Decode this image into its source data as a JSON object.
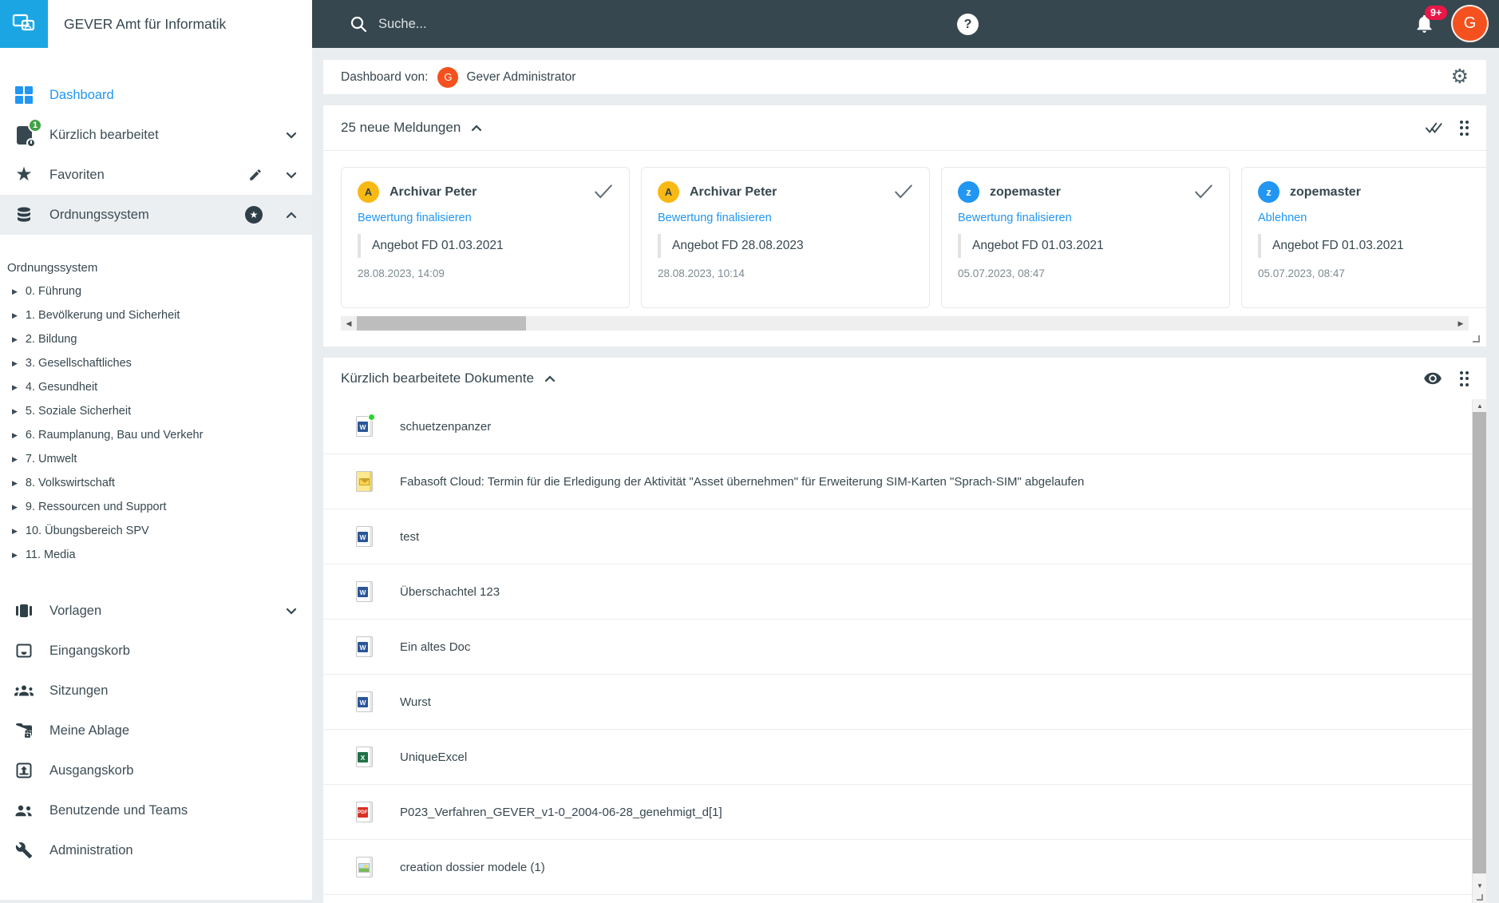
{
  "app": {
    "title": "GEVER Amt für Informatik"
  },
  "topbar": {
    "search_placeholder": "Suche...",
    "help_glyph": "?",
    "notification_count": "9+",
    "avatar_initial": "G"
  },
  "sidebar": {
    "items": [
      {
        "label": "Dashboard"
      },
      {
        "label": "Kürzlich bearbeitet",
        "badge": "1"
      },
      {
        "label": "Favoriten"
      },
      {
        "label": "Ordnungssystem"
      }
    ],
    "tree": {
      "root": "Ordnungssystem",
      "nodes": [
        "0. Führung",
        "1. Bevölkerung und Sicherheit",
        "2. Bildung",
        "3. Gesellschaftliches",
        "4. Gesundheit",
        "5. Soziale Sicherheit",
        "6. Raumplanung, Bau und Verkehr",
        "7. Umwelt",
        "8. Volkswirtschaft",
        "9. Ressourcen und Support",
        "10. Übungsbereich SPV",
        "11. Media"
      ]
    },
    "bottom": [
      "Vorlagen",
      "Eingangskorb",
      "Sitzungen",
      "Meine Ablage",
      "Ausgangskorb",
      "Benutzende und Teams",
      "Administration"
    ]
  },
  "dashboard_header": {
    "label": "Dashboard von:",
    "avatar_initial": "G",
    "user": "Gever Administrator"
  },
  "notifications": {
    "title": "25 neue Meldungen",
    "cards": [
      {
        "user": "Archivar Peter",
        "initial": "A",
        "action": "Bewertung finalisieren",
        "subject": "Angebot FD 01.03.2021",
        "date": "28.08.2023, 14:09"
      },
      {
        "user": "Archivar Peter",
        "initial": "A",
        "action": "Bewertung finalisieren",
        "subject": "Angebot FD 28.08.2023",
        "date": "28.08.2023, 10:14"
      },
      {
        "user": "zopemaster",
        "initial": "z",
        "action": "Bewertung finalisieren",
        "subject": "Angebot FD 01.03.2021",
        "date": "05.07.2023, 08:47"
      },
      {
        "user": "zopemaster",
        "initial": "z",
        "action": "Ablehnen",
        "subject": "Angebot FD 01.03.2021",
        "date": "05.07.2023, 08:47"
      }
    ]
  },
  "documents": {
    "title": "Kürzlich bearbeitete Dokumente",
    "rows": [
      {
        "name": "schuetzenpanzer",
        "type": "word",
        "unread": true
      },
      {
        "name": "Fabasoft Cloud: Termin für die Erledigung der Aktivität \"Asset übernehmen\" für Erweiterung SIM-Karten \"Sprach-SIM\" abgelaufen",
        "type": "email"
      },
      {
        "name": "test",
        "type": "word"
      },
      {
        "name": "Überschachtel 123",
        "type": "word"
      },
      {
        "name": "Ein altes Doc",
        "type": "word"
      },
      {
        "name": "Wurst",
        "type": "word"
      },
      {
        "name": "UniqueExcel",
        "type": "excel"
      },
      {
        "name": "P023_Verfahren_GEVER_v1-0_2004-06-28_genehmigt_d[1]",
        "type": "pdf"
      },
      {
        "name": "creation dossier modele (1)",
        "type": "image"
      }
    ]
  },
  "glyphs": {
    "star": "★",
    "tree_arrow": "▶",
    "scroll_left": "◀",
    "scroll_right": "▶",
    "scroll_up": "▲",
    "scroll_down": "▼",
    "gear": "⚙",
    "file_word_letter": "W",
    "file_excel_letter": "X",
    "file_pdf_label": "PDF"
  },
  "colors": {
    "topbar": "#37474f",
    "accent_blue": "#2196f3",
    "logo_blue": "#1ba6e3",
    "avatar_orange": "#f4511e",
    "avatar_amber": "#f9b915",
    "badge_green": "#43a047",
    "notif_badge_red": "#e91748",
    "background": "#e9edf0"
  }
}
